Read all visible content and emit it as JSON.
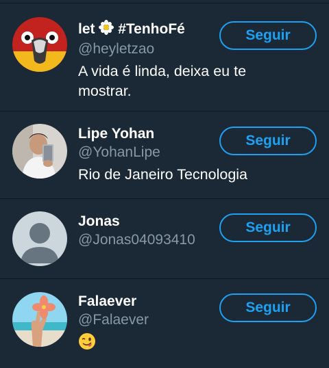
{
  "follow_label": "Seguir",
  "accent": "#1da1f2",
  "users": [
    {
      "name_prefix": "let",
      "flower_icon": "daisy-icon",
      "name_suffix": "#TenhoFé",
      "handle": "@heyletzao",
      "bio": "A vida é linda, deixa eu te mostrar."
    },
    {
      "name": "Lipe Yohan",
      "handle": "@YohanLipe",
      "bio": "Rio de Janeiro Tecnologia"
    },
    {
      "name": "Jonas",
      "handle": "@Jonas04093410",
      "bio": ""
    },
    {
      "name": "Falaever",
      "handle": "@Falaever",
      "bio_icon": "winking-face-tongue-emoji"
    }
  ]
}
